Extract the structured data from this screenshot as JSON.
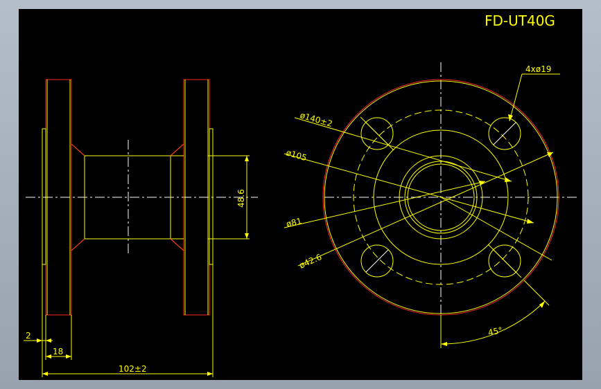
{
  "drawing": {
    "title": "FD-UT40G",
    "dimensions": {
      "bolt_holes": "4xø19",
      "pcd": "ø140±2",
      "flange_face": "ø105",
      "raised_face": "ø81",
      "bore": "ø42.6",
      "angle": "45°",
      "height": "48.6",
      "gasket_thickness": "2",
      "flange_thickness": "18",
      "overall_length": "102±2"
    }
  },
  "colors": {
    "background": "#000000",
    "geometry": "#ffff00",
    "outline": "#ff2a1a",
    "centerline": "#ffffff",
    "frame": "#a3adb8"
  }
}
